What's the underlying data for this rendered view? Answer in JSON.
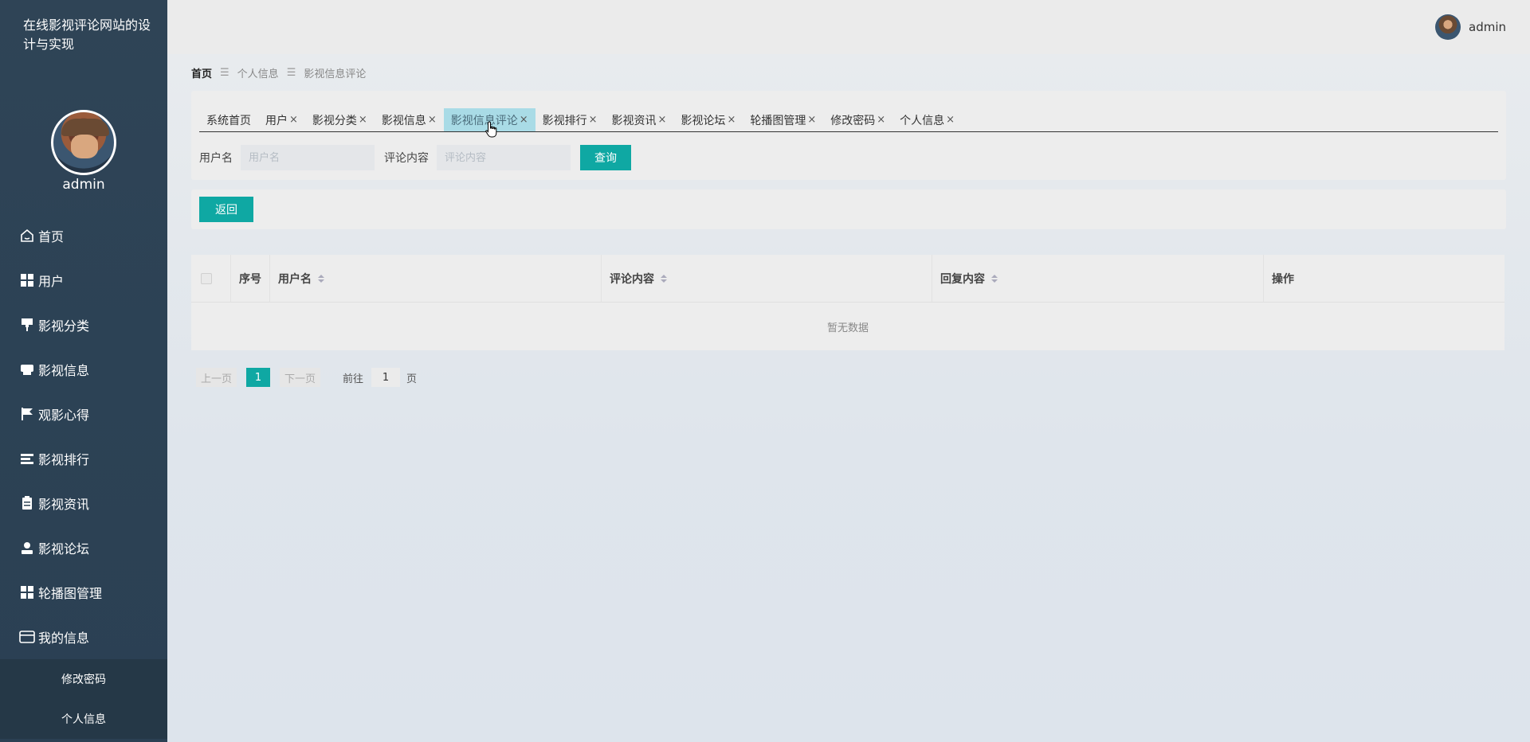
{
  "site": {
    "title": "在线影视评论网站的设计与实现",
    "username": "admin"
  },
  "header": {
    "username": "admin"
  },
  "sidebar": {
    "items": [
      {
        "label": "首页",
        "icon": "home-icon"
      },
      {
        "label": "用户",
        "icon": "grid-icon"
      },
      {
        "label": "影视分类",
        "icon": "brush-icon"
      },
      {
        "label": "影视信息",
        "icon": "printer-icon"
      },
      {
        "label": "观影心得",
        "icon": "flag-icon"
      },
      {
        "label": "影视排行",
        "icon": "list-icon"
      },
      {
        "label": "影视资讯",
        "icon": "clipboard-icon"
      },
      {
        "label": "影视论坛",
        "icon": "person-icon"
      },
      {
        "label": "轮播图管理",
        "icon": "grid-icon"
      },
      {
        "label": "我的信息",
        "icon": "card-icon"
      }
    ],
    "submenu": [
      {
        "label": "修改密码"
      },
      {
        "label": "个人信息"
      }
    ]
  },
  "breadcrumb": {
    "home": "首页",
    "sep1": "☰",
    "level1": "个人信息",
    "sep2": "☰",
    "level2": "影视信息评论"
  },
  "tabs": [
    {
      "label": "系统首页",
      "closable": false,
      "active": false
    },
    {
      "label": "用户",
      "closable": true,
      "active": false
    },
    {
      "label": "影视分类",
      "closable": true,
      "active": false
    },
    {
      "label": "影视信息",
      "closable": true,
      "active": false
    },
    {
      "label": "影视信息评论",
      "closable": true,
      "active": true
    },
    {
      "label": "影视排行",
      "closable": true,
      "active": false
    },
    {
      "label": "影视资讯",
      "closable": true,
      "active": false
    },
    {
      "label": "影视论坛",
      "closable": true,
      "active": false
    },
    {
      "label": "轮播图管理",
      "closable": true,
      "active": false
    },
    {
      "label": "修改密码",
      "closable": true,
      "active": false
    },
    {
      "label": "个人信息",
      "closable": true,
      "active": false
    }
  ],
  "tab_close_glyph": "×",
  "search": {
    "username_label": "用户名",
    "username_placeholder": "用户名",
    "username_value": "",
    "content_label": "评论内容",
    "content_placeholder": "评论内容",
    "content_value": "",
    "query_button": "查询"
  },
  "actions": {
    "back_button": "返回"
  },
  "table": {
    "columns": [
      "序号",
      "用户名",
      "评论内容",
      "回复内容",
      "操作"
    ],
    "empty_text": "暂无数据",
    "rows": []
  },
  "pagination": {
    "prev": "上一页",
    "current": "1",
    "next": "下一页",
    "goto_label": "前往",
    "goto_value": "1",
    "goto_suffix": "页"
  },
  "colors": {
    "sidebar_bg": "#2f4456",
    "accent": "#0fa8a3",
    "active_tab": "#a9dbe6"
  }
}
